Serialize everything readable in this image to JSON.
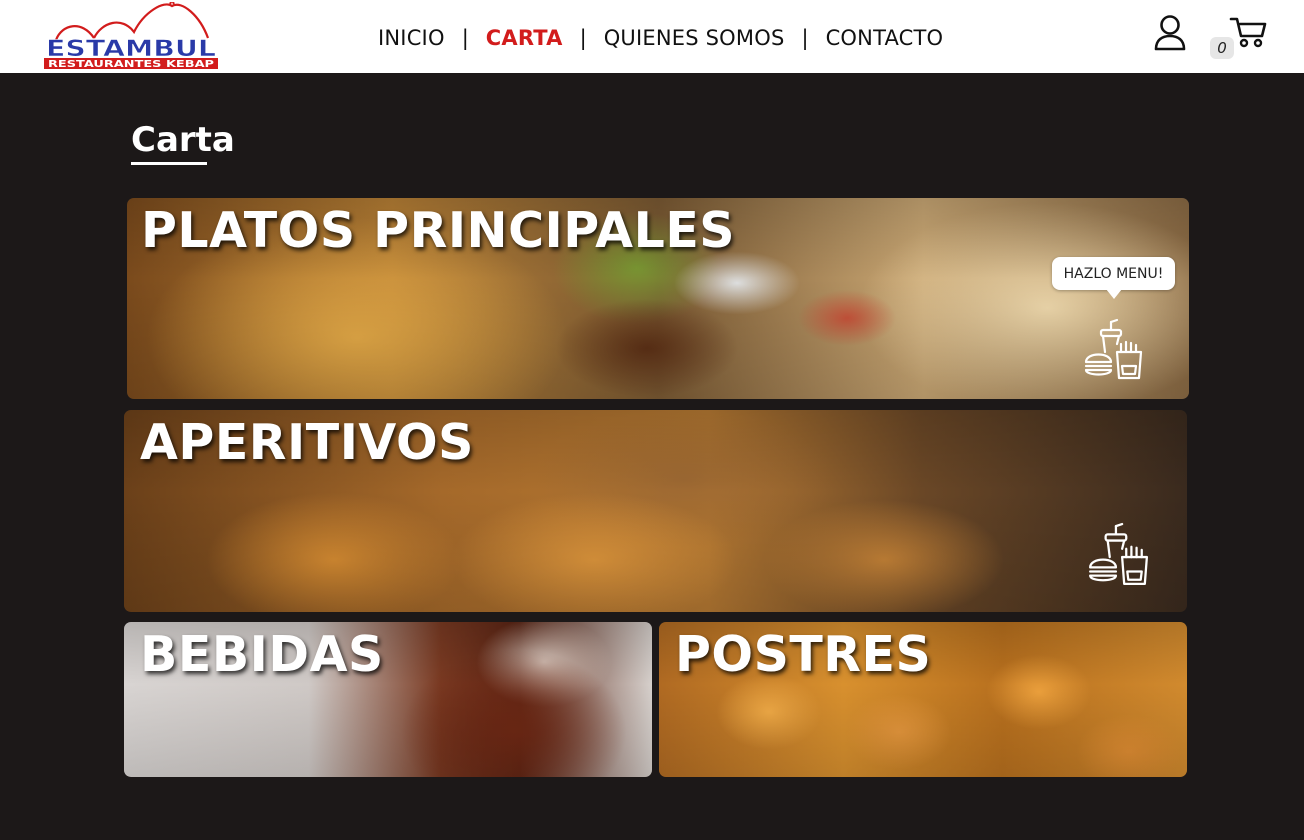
{
  "brand": {
    "name": "ESTAMBUL",
    "tagline": "RESTAURANTES KEBAP",
    "primary_color": "#d21c1c",
    "secondary_color": "#2a3aa8"
  },
  "nav": {
    "items": [
      {
        "label": "INICIO",
        "active": false
      },
      {
        "label": "CARTA",
        "active": true
      },
      {
        "label": "QUIENES SOMOS",
        "active": false
      },
      {
        "label": "CONTACTO",
        "active": false
      }
    ],
    "separator": "|",
    "active_color": "#d21c1c"
  },
  "header_icons": {
    "user": "user-icon",
    "cart": "cart-icon",
    "cart_count": "0"
  },
  "page": {
    "title": "Carta"
  },
  "categories": [
    {
      "label": "PLATOS PRINCIPALES",
      "icon": "combo-menu-icon",
      "tooltip": "HAZLO MENU!"
    },
    {
      "label": "APERITIVOS",
      "icon": "combo-menu-icon"
    },
    {
      "label": "BEBIDAS"
    },
    {
      "label": "POSTRES"
    }
  ]
}
